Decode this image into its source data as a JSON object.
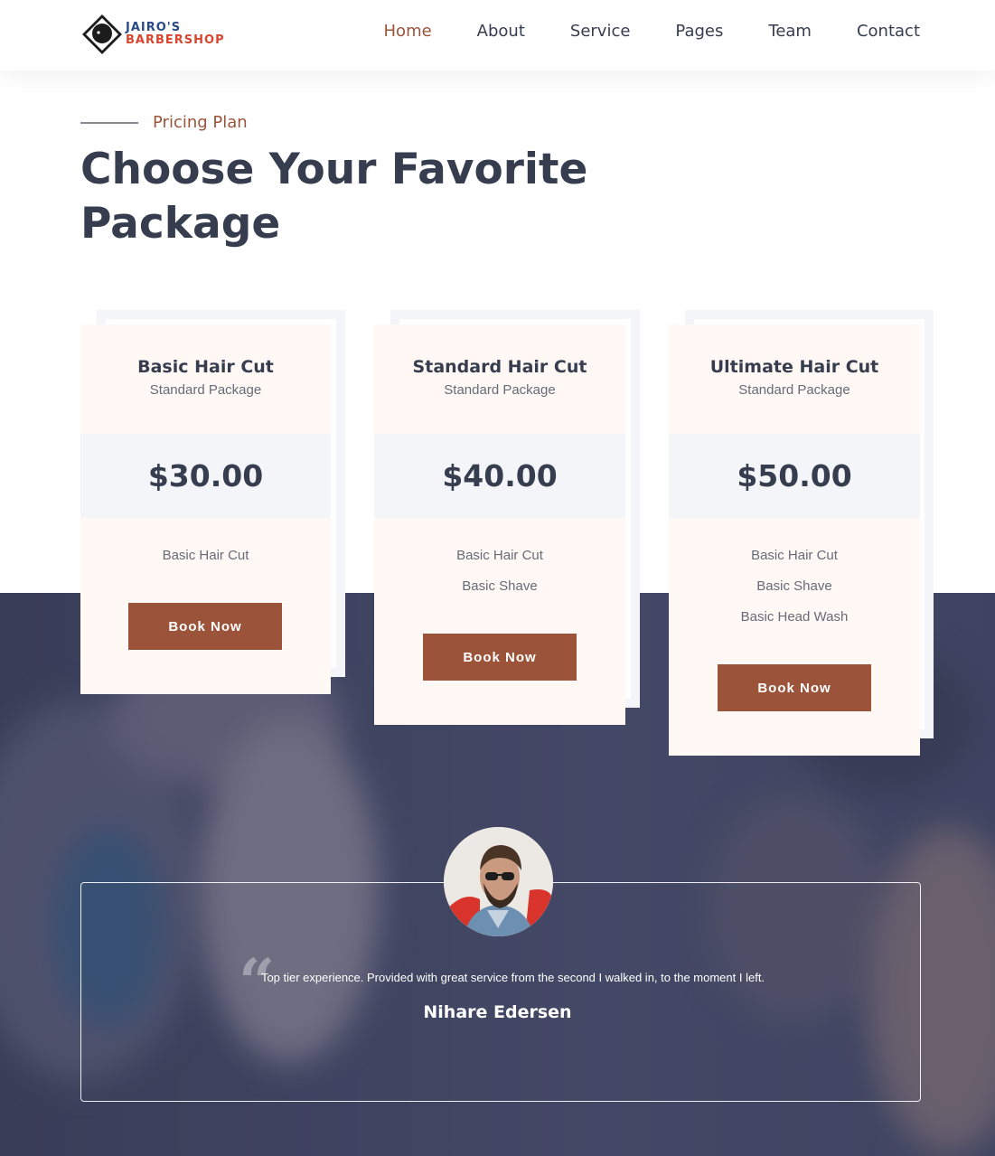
{
  "header": {
    "logo": {
      "line1": "JAIRO'S",
      "line2": "BARBERSHOP"
    },
    "nav": [
      {
        "label": "Home",
        "active": true
      },
      {
        "label": "About"
      },
      {
        "label": "Service"
      },
      {
        "label": "Pages"
      },
      {
        "label": "Team"
      },
      {
        "label": "Contact"
      }
    ]
  },
  "pricing": {
    "eyebrow": "Pricing Plan",
    "title": "Choose Your Favorite Package",
    "plans": [
      {
        "name": "Basic Hair Cut",
        "package": "Standard Package",
        "price": "$30.00",
        "features": [
          "Basic Hair Cut"
        ],
        "button": "Book Now"
      },
      {
        "name": "Standard Hair Cut",
        "package": "Standard Package",
        "price": "$40.00",
        "features": [
          "Basic Hair Cut",
          "Basic Shave"
        ],
        "button": "Book Now"
      },
      {
        "name": "Ultimate Hair Cut",
        "package": "Standard Package",
        "price": "$50.00",
        "features": [
          "Basic Hair Cut",
          "Basic Shave",
          "Basic Head Wash"
        ],
        "button": "Book Now"
      }
    ]
  },
  "testimonial": {
    "quote": "Top tier experience. Provided with great service from the second I walked in, to the moment I left.",
    "author": "Nihare Edersen"
  },
  "colors": {
    "accent": "#9b543a",
    "heading": "#363d4f",
    "card_bg": "#fff8f5",
    "band_bg": "#f4f5f8"
  }
}
